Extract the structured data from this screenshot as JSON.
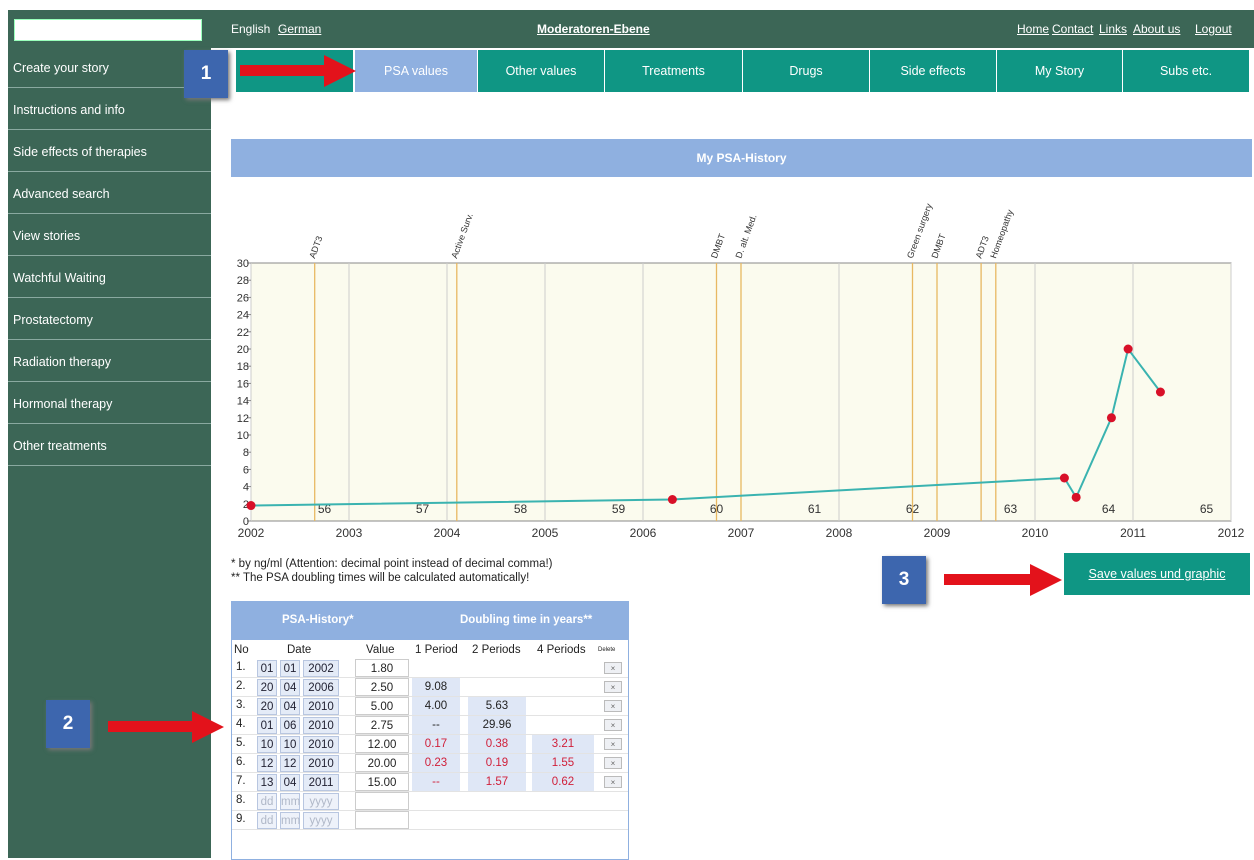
{
  "topbar": {
    "lang_en": "English",
    "lang_de": "German",
    "title": "Moderatoren-Ebene",
    "links": [
      "Home",
      "Contact",
      "Links",
      "About us",
      "Logout"
    ]
  },
  "sidebar": {
    "items": [
      "Create your story",
      "Instructions and info",
      "Side effects of therapies",
      "Advanced search",
      "View stories",
      "Watchful Waiting",
      "Prostatectomy",
      "Radiation therapy",
      "Hormonal therapy",
      "Other treatments"
    ]
  },
  "tabs": [
    "PSA values",
    "Other values",
    "Treatments",
    "Drugs",
    "Side effects",
    "My Story",
    "Subs etc."
  ],
  "chart_header": "My PSA-History",
  "chart_data": {
    "type": "line",
    "title": "My PSA-History",
    "xlim": [
      2002,
      2012
    ],
    "ylim": [
      0,
      30
    ],
    "x_ticks": [
      "2002",
      "2003",
      "2004",
      "2005",
      "2006",
      "2007",
      "2008",
      "2009",
      "2010",
      "2011",
      "2012"
    ],
    "y_ticks": [
      "0",
      "2",
      "4",
      "6",
      "8",
      "10",
      "12",
      "14",
      "16",
      "18",
      "20",
      "22",
      "24",
      "26",
      "28",
      "30"
    ],
    "age_labels": [
      "56",
      "57",
      "58",
      "59",
      "60",
      "61",
      "62",
      "63",
      "64",
      "65"
    ],
    "age_positions": [
      2002.75,
      2003.75,
      2004.75,
      2005.75,
      2006.75,
      2007.75,
      2008.75,
      2009.75,
      2010.75,
      2011.75
    ],
    "events": [
      {
        "label": "ADT3",
        "x": 2002.65
      },
      {
        "label": "Active Surv.",
        "x": 2004.1
      },
      {
        "label": "DMBT",
        "x": 2006.75
      },
      {
        "label": "D. alt. Med.",
        "x": 2007.0
      },
      {
        "label": "Green surgery",
        "x": 2008.75
      },
      {
        "label": "DMBT",
        "x": 2009.0
      },
      {
        "label": "ADT3",
        "x": 2009.45
      },
      {
        "label": "Homeopathy",
        "x": 2009.6
      }
    ],
    "series": [
      {
        "x": [
          2002.0,
          2006.3,
          2010.3,
          2010.42,
          2010.78,
          2010.95,
          2011.28
        ],
        "y": [
          1.8,
          2.5,
          5.0,
          2.75,
          12.0,
          20.0,
          15.0
        ]
      }
    ],
    "colors": {
      "line": "#3ab3b0",
      "point": "#d81028",
      "event": "#e8b862",
      "grid": "#cccccc",
      "bg": "#fbfbee"
    }
  },
  "notes": {
    "n1": "* by ng/ml (Attention: decimal point instead of decimal comma!)",
    "n2": "** The PSA doubling times will be calculated automatically!"
  },
  "save_button": "Save values und graphic",
  "badges": [
    "1",
    "2",
    "3"
  ],
  "table": {
    "header_left": "PSA-History*",
    "header_right": "Doubling time in years**",
    "columns": [
      "No",
      "Date",
      "Value",
      "1 Period",
      "2 Periods",
      "4 Periods",
      "Delete"
    ],
    "rows": [
      {
        "no": "1.",
        "d": "01",
        "m": "01",
        "y": "2002",
        "value": "1.80",
        "p1": "",
        "p2": "",
        "p4": ""
      },
      {
        "no": "2.",
        "d": "20",
        "m": "04",
        "y": "2006",
        "value": "2.50",
        "p1": "9.08",
        "p2": "",
        "p4": ""
      },
      {
        "no": "3.",
        "d": "20",
        "m": "04",
        "y": "2010",
        "value": "5.00",
        "p1": "4.00",
        "p2": "5.63",
        "p4": ""
      },
      {
        "no": "4.",
        "d": "01",
        "m": "06",
        "y": "2010",
        "value": "2.75",
        "p1": "--",
        "p2": "29.96",
        "p4": ""
      },
      {
        "no": "5.",
        "d": "10",
        "m": "10",
        "y": "2010",
        "value": "12.00",
        "p1": "0.17",
        "p2": "0.38",
        "p4": "3.21"
      },
      {
        "no": "6.",
        "d": "12",
        "m": "12",
        "y": "2010",
        "value": "20.00",
        "p1": "0.23",
        "p2": "0.19",
        "p4": "1.55"
      },
      {
        "no": "7.",
        "d": "13",
        "m": "04",
        "y": "2011",
        "value": "15.00",
        "p1": "--",
        "p2": "1.57",
        "p4": "0.62"
      }
    ],
    "empty_rows": [
      "8.",
      "9."
    ],
    "placeholders": {
      "d": "dd",
      "m": "mm",
      "y": "yyyy"
    }
  }
}
